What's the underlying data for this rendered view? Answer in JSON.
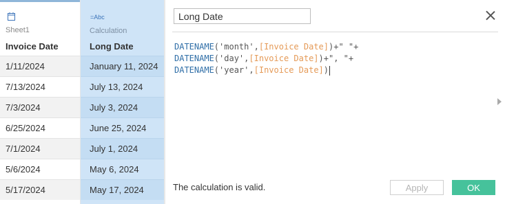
{
  "grid": {
    "columns": [
      {
        "icon": "calendar-icon",
        "source": "Sheet1",
        "name": "Invoice Date",
        "rows": [
          "1/11/2024",
          "7/13/2024",
          "7/3/2024",
          "6/25/2024",
          "7/1/2024",
          "5/6/2024",
          "5/17/2024"
        ]
      },
      {
        "icon_text": "=Abc",
        "source": "Calculation",
        "name": "Long Date",
        "rows": [
          "January 11, 2024",
          "July 13, 2024",
          "July 3, 2024",
          "June 25, 2024",
          "July 1, 2024",
          "May 6, 2024",
          "May 17, 2024"
        ]
      }
    ]
  },
  "calc": {
    "name_value": "Long Date",
    "formula_lines": [
      {
        "fn": "DATENAME",
        "arg": "'month'",
        "field": "[Invoice Date]",
        "tail": ")+\" \"+"
      },
      {
        "fn": "DATENAME",
        "arg": "'day'",
        "field": "[Invoice Date]",
        "tail": ")+\", \"+"
      },
      {
        "fn": "DATENAME",
        "arg": "'year'",
        "field": "[Invoice Date]",
        "tail": ")"
      }
    ],
    "status": "The calculation is valid.",
    "apply_label": "Apply",
    "ok_label": "OK"
  },
  "colors": {
    "function": "#2f6ea7",
    "field": "#e59a57",
    "ok_button": "#46c29b",
    "selected_column": "#cfe4f7"
  }
}
